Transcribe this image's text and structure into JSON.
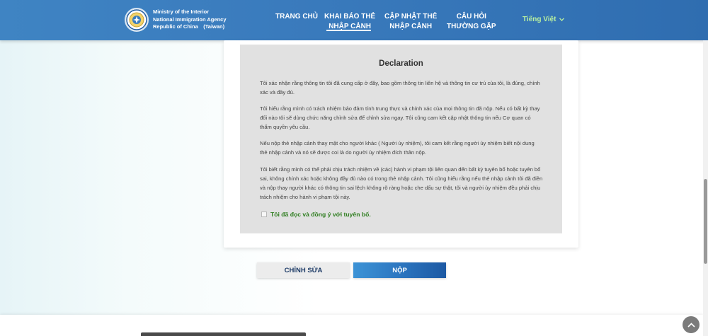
{
  "header": {
    "logo": {
      "line1": "Ministry of the Interior",
      "line2": "National Immigration Agency",
      "line3": "Republic of China　(Taiwan)"
    },
    "nav": [
      {
        "line1": "TRANG CHỦ",
        "line2": ""
      },
      {
        "line1": "KHAI BÁO THẺ",
        "line2": "NHẬP CẢNH",
        "active": true
      },
      {
        "line1": "CẬP NHẬT THẺ",
        "line2": "NHẬP CẢNH"
      },
      {
        "line1": "CÂU HỎI",
        "line2": "THƯỜNG GẶP"
      }
    ],
    "language": "Tiếng Việt"
  },
  "declaration": {
    "title": "Declaration",
    "paragraphs": [
      "Tôi xác nhận rằng thông tin tôi đã cung cấp ở đây, bao gồm thông tin liên hệ và thông tin cư trú của tôi, là đúng, chính xác và đầy đủ.",
      "Tôi hiểu rằng mình có trách nhiệm bảo đảm tính trung thực và chính xác của mọi thông tin đã nộp. Nếu có bất kỳ thay đổi nào tôi sẽ dùng chức năng chỉnh sửa để chỉnh sửa ngay. Tôi cũng cam kết cập nhật thông tin nếu Cơ quan có thẩm quyền yêu cầu.",
      "Nếu nộp thẻ nhập cảnh thay mặt cho người khác ( Người ủy nhiệm), tôi cam kết rằng người ủy nhiệm biết nội dung thẻ nhập cảnh và nó sẽ được coi là do người ủy nhiệm đích thân nộp.",
      "Tôi biết rằng mình có thể phải chịu trách nhiệm về (các) hành vi phạm tội liên quan đến bất kỳ tuyên bố hoặc tuyên bố sai, không chính xác hoặc không đầy đủ nào có trong thẻ nhập cảnh. Tôi cũng hiểu rằng nếu thẻ nhập cảnh tôi đã điền và nộp thay người khác có thông tin sai lệch không rõ ràng hoặc che dấu sự thật, tôi và người ủy nhiệm đều phải chịu trách nhiệm cho hành vi phạm tội này."
    ],
    "agree_label": "Tôi đã đọc và đồng ý với tuyên bố.",
    "agree_checked": false
  },
  "buttons": {
    "edit": "CHỈNH SỬA",
    "submit": "NỘP"
  },
  "colors": {
    "header": "#3a7bbd",
    "language": "#b9f0a0",
    "agree_text": "#2e7d1f",
    "submit": "#2c76c0"
  },
  "icons": {
    "logo": "immigration-seal-icon",
    "language_dropdown": "chevron-down-icon",
    "back_to_top": "chevron-up-icon"
  }
}
